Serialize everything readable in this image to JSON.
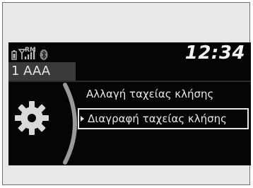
{
  "status": {
    "time": "12:34",
    "roaming": "RM",
    "icons": [
      "phone-battery-icon",
      "signal-strength-icon",
      "roaming-indicator",
      "bluetooth-icon"
    ]
  },
  "source": {
    "label": "1 AAA"
  },
  "menu": {
    "items": [
      {
        "label": "Αλλαγή ταχείας κλήσης",
        "selected": false
      },
      {
        "label": "Διαγραφή ταχείας κλήσης",
        "selected": true
      }
    ]
  },
  "side_icon": "settings-gear-icon",
  "colors": {
    "screen_bg": "#050505",
    "text": "#e8e8e8",
    "frame_bg": "#e8e8e8"
  }
}
